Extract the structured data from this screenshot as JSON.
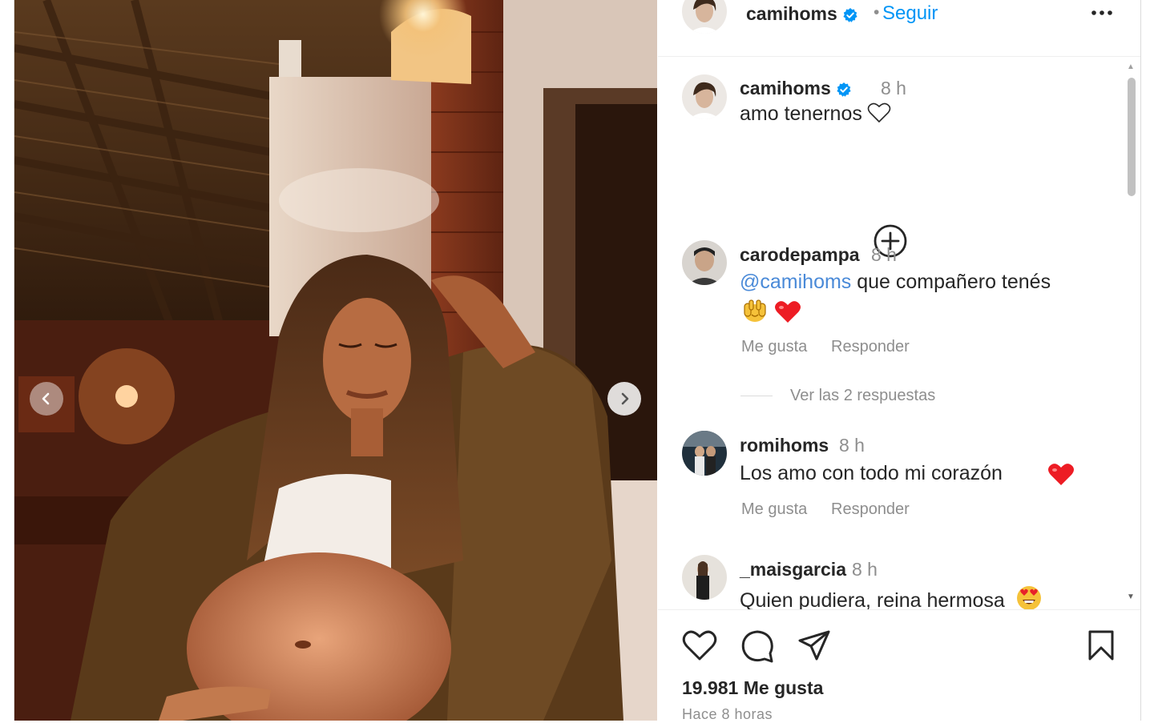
{
  "post": {
    "author": "camihoms",
    "follow_label": "Seguir",
    "separator": "•",
    "caption": {
      "username": "camihoms",
      "time": "8 h",
      "text": "amo tenernos"
    },
    "comments": [
      {
        "username": "carodepampa",
        "time": "8 h",
        "mention": "@camihoms",
        "text": " que compañero tenés",
        "like_label": "Me gusta",
        "reply_label": "Responder",
        "view_replies": "Ver las 2 respuestas",
        "emojis": [
          "raising-hands-emoji",
          "red-heart-emoji"
        ]
      },
      {
        "username": "romihoms",
        "time": "8 h",
        "text": "Los amo con todo mi corazón",
        "like_label": "Me gusta",
        "reply_label": "Responder",
        "emojis": [
          "red-heart-emoji"
        ]
      },
      {
        "username": "_maisgarcia",
        "time": "8 h",
        "text": "Quien pudiera, reina hermosa",
        "emojis": [
          "heart-eyes-emoji"
        ]
      }
    ],
    "likes": "19.981 Me gusta",
    "posted_ago": "Hace 8 horas"
  },
  "icons": [
    "verified-badge-icon",
    "more-options-icon",
    "load-more-comments-icon",
    "heart-icon",
    "comment-icon",
    "share-icon",
    "save-icon",
    "chevron-left-icon",
    "chevron-right-icon"
  ],
  "colors": {
    "accent": "#0095f6",
    "mention": "#4a8ad8",
    "heart": "#ed1c24",
    "muted": "#8e8e8e"
  }
}
